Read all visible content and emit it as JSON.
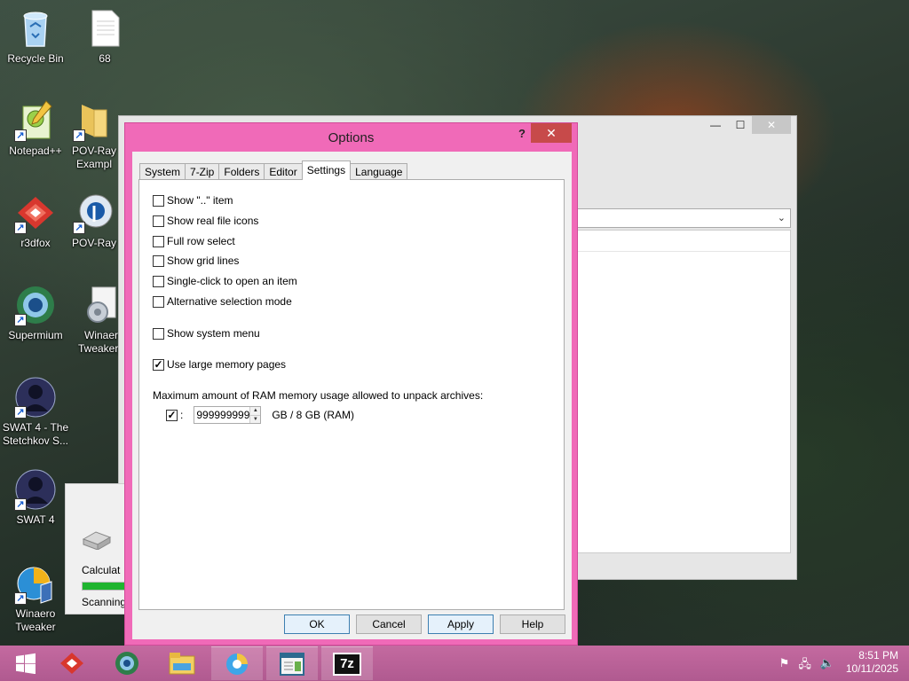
{
  "desktop": {
    "icons": [
      {
        "label": "Recycle Bin",
        "icon": "recycle-bin-icon"
      },
      {
        "label": "68",
        "icon": "file-icon"
      },
      {
        "label": "Notepad++",
        "icon": "notepad-plus-plus-icon"
      },
      {
        "label": "POV-Ray Exampl",
        "icon": "folder-icon"
      },
      {
        "label": "r3dfox",
        "icon": "r3dfox-icon"
      },
      {
        "label": "POV-Ray",
        "icon": "povray-icon"
      },
      {
        "label": "Supermium",
        "icon": "supermium-icon"
      },
      {
        "label": "Winaer Tweaker_",
        "icon": "winaero-tweaker-icon"
      },
      {
        "label": "SWAT 4 - The Stetchkov S...",
        "icon": "swat4-icon"
      },
      {
        "label": "SWAT 4",
        "icon": "swat4-icon"
      },
      {
        "label": "Winaero Tweaker",
        "icon": "winaero-tweaker-icon"
      }
    ]
  },
  "background_window": {
    "controls": {
      "minimize": "—",
      "maximize": "☐",
      "close": "✕"
    },
    "dropdown_arrow": "⌄"
  },
  "progress_window": {
    "calc_label": "Calculat",
    "scan_label": "Scanning:",
    "progress": 1.0
  },
  "dialog": {
    "title": "Options",
    "help_label": "?",
    "close_label": "✕",
    "tabs": [
      {
        "label": "System",
        "active": false
      },
      {
        "label": "7-Zip",
        "active": false
      },
      {
        "label": "Folders",
        "active": false
      },
      {
        "label": "Editor",
        "active": false
      },
      {
        "label": "Settings",
        "active": true
      },
      {
        "label": "Language",
        "active": false
      }
    ],
    "settings": {
      "show_dotdot": {
        "label": "Show \"..\" item",
        "checked": false
      },
      "show_real_icons": {
        "label": "Show real file icons",
        "checked": false
      },
      "full_row": {
        "label": "Full row select",
        "checked": false
      },
      "grid_lines": {
        "label": "Show grid lines",
        "checked": false
      },
      "single_click": {
        "label": "Single-click to open an item",
        "checked": false
      },
      "alt_selection": {
        "label": "Alternative selection mode",
        "checked": false
      },
      "system_menu": {
        "label": "Show system menu",
        "checked": false
      },
      "large_pages": {
        "label": "Use large memory pages",
        "checked": true
      },
      "ram_label": "Maximum amount of RAM memory usage allowed to unpack archives:",
      "ram_checked": true,
      "ram_colon": ":",
      "ram_value": "999999999",
      "ram_info": "GB / 8 GB (RAM)"
    },
    "buttons": {
      "ok": "OK",
      "cancel": "Cancel",
      "apply": "Apply",
      "help": "Help"
    }
  },
  "taskbar": {
    "start": "windows-start-icon",
    "items": [
      "r3dfox-icon",
      "supermium-icon",
      "file-explorer-icon",
      "browser-icon",
      "window-app-icon",
      "7zip-icon"
    ],
    "seven_zip_label": "7z",
    "tray": {
      "time": "8:51 PM",
      "date": "10/11/2025"
    }
  },
  "colors": {
    "dialog_frame": "#f06ab8",
    "taskbar": "#b85f95",
    "close_button": "#c74a4a"
  }
}
